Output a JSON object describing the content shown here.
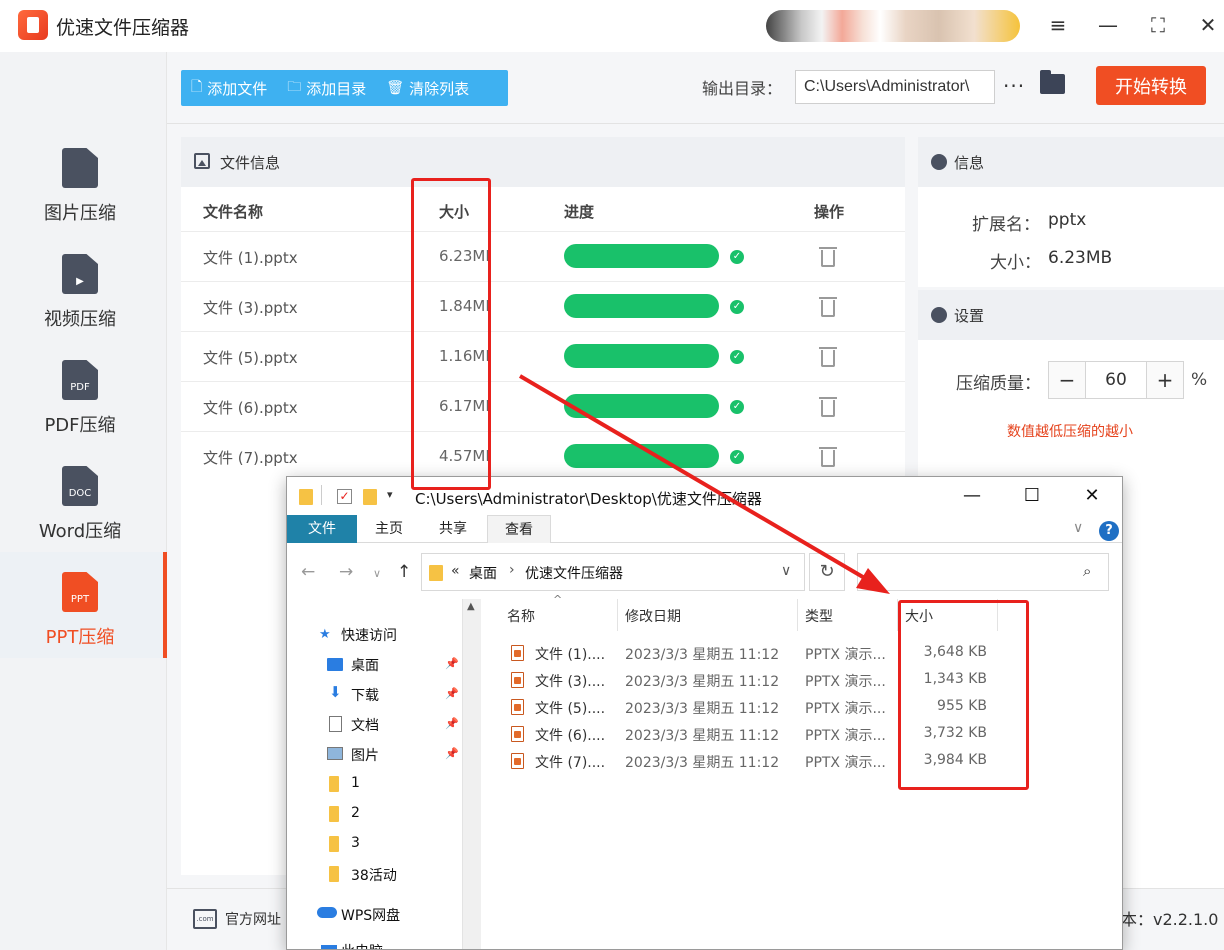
{
  "app": {
    "title": "优速文件压缩器",
    "window_controls": [
      "≡",
      "—",
      "⛶",
      "✕"
    ]
  },
  "sidebar": {
    "items": [
      {
        "label": "图片压缩",
        "tag": "",
        "active": false
      },
      {
        "label": "视频压缩",
        "tag": "▶",
        "active": false
      },
      {
        "label": "PDF压缩",
        "tag": "PDF",
        "active": false
      },
      {
        "label": "Word压缩",
        "tag": "DOC",
        "active": false
      },
      {
        "label": "PPT压缩",
        "tag": "PPT",
        "active": true
      }
    ]
  },
  "toolbar": {
    "add_file": "添加文件",
    "add_dir": "添加目录",
    "clear_list": "清除列表",
    "output_label": "输出目录：",
    "output_path": "C:\\Users\\Administrator\\",
    "more": "···",
    "start": "开始转换"
  },
  "file_panel": {
    "title": "文件信息",
    "columns": {
      "name": "文件名称",
      "size": "大小",
      "progress": "进度",
      "action": "操作"
    },
    "rows": [
      {
        "name": "文件 (1).pptx",
        "size": "6.23MB",
        "progress": 1.0
      },
      {
        "name": "文件 (3).pptx",
        "size": "1.84MB",
        "progress": 1.0
      },
      {
        "name": "文件 (5).pptx",
        "size": "1.16MB",
        "progress": 1.0
      },
      {
        "name": "文件 (6).pptx",
        "size": "6.17MB",
        "progress": 1.0
      },
      {
        "name": "文件 (7).pptx",
        "size": "4.57MB",
        "progress": 1.0
      }
    ]
  },
  "info": {
    "title": "信息",
    "ext_label": "扩展名：",
    "ext": "pptx",
    "size_label": "大小：",
    "size": "6.23MB"
  },
  "settings": {
    "title": "设置",
    "quality_label": "压缩质量：",
    "minus": "−",
    "plus": "+",
    "quality": "60",
    "unit": "%",
    "hint": "数值越低压缩的越小"
  },
  "footer": {
    "site": "官方网址",
    "version": "本：v2.2.1.0"
  },
  "explorer": {
    "path": "C:\\Users\\Administrator\\Desktop\\优速文件压缩器",
    "tabs": [
      "文件",
      "主页",
      "共享",
      "查看"
    ],
    "breadcrumb": [
      "«",
      "桌面",
      "›",
      "优速文件压缩器"
    ],
    "tree": [
      {
        "label": "快速访问",
        "pinned": false
      },
      {
        "label": "桌面",
        "pinned": true
      },
      {
        "label": "下载",
        "pinned": true
      },
      {
        "label": "文档",
        "pinned": true
      },
      {
        "label": "图片",
        "pinned": true
      },
      {
        "label": "1",
        "pinned": false
      },
      {
        "label": "2",
        "pinned": false
      },
      {
        "label": "3",
        "pinned": false
      },
      {
        "label": "38活动",
        "pinned": false
      },
      {
        "label": "WPS网盘",
        "pinned": false
      },
      {
        "label": "此电脑",
        "pinned": false
      }
    ],
    "columns": {
      "name": "名称",
      "date": "修改日期",
      "type": "类型",
      "size": "大小"
    },
    "files": [
      {
        "name": "文件 (1)....",
        "date": "2023/3/3 星期五 11:12",
        "type": "PPTX 演示...",
        "size": "3,648 KB"
      },
      {
        "name": "文件 (3)....",
        "date": "2023/3/3 星期五 11:12",
        "type": "PPTX 演示...",
        "size": "1,343 KB"
      },
      {
        "name": "文件 (5)....",
        "date": "2023/3/3 星期五 11:12",
        "type": "PPTX 演示...",
        "size": "955 KB"
      },
      {
        "name": "文件 (6)....",
        "date": "2023/3/3 星期五 11:12",
        "type": "PPTX 演示...",
        "size": "3,732 KB"
      },
      {
        "name": "文件 (7)....",
        "date": "2023/3/3 星期五 11:12",
        "type": "PPTX 演示...",
        "size": "3,984 KB"
      }
    ]
  },
  "colors": {
    "accent": "#f04e23",
    "toolbar_blue": "#3eb1f1",
    "progress": "#19c16a",
    "annotation": "#e8211d"
  }
}
